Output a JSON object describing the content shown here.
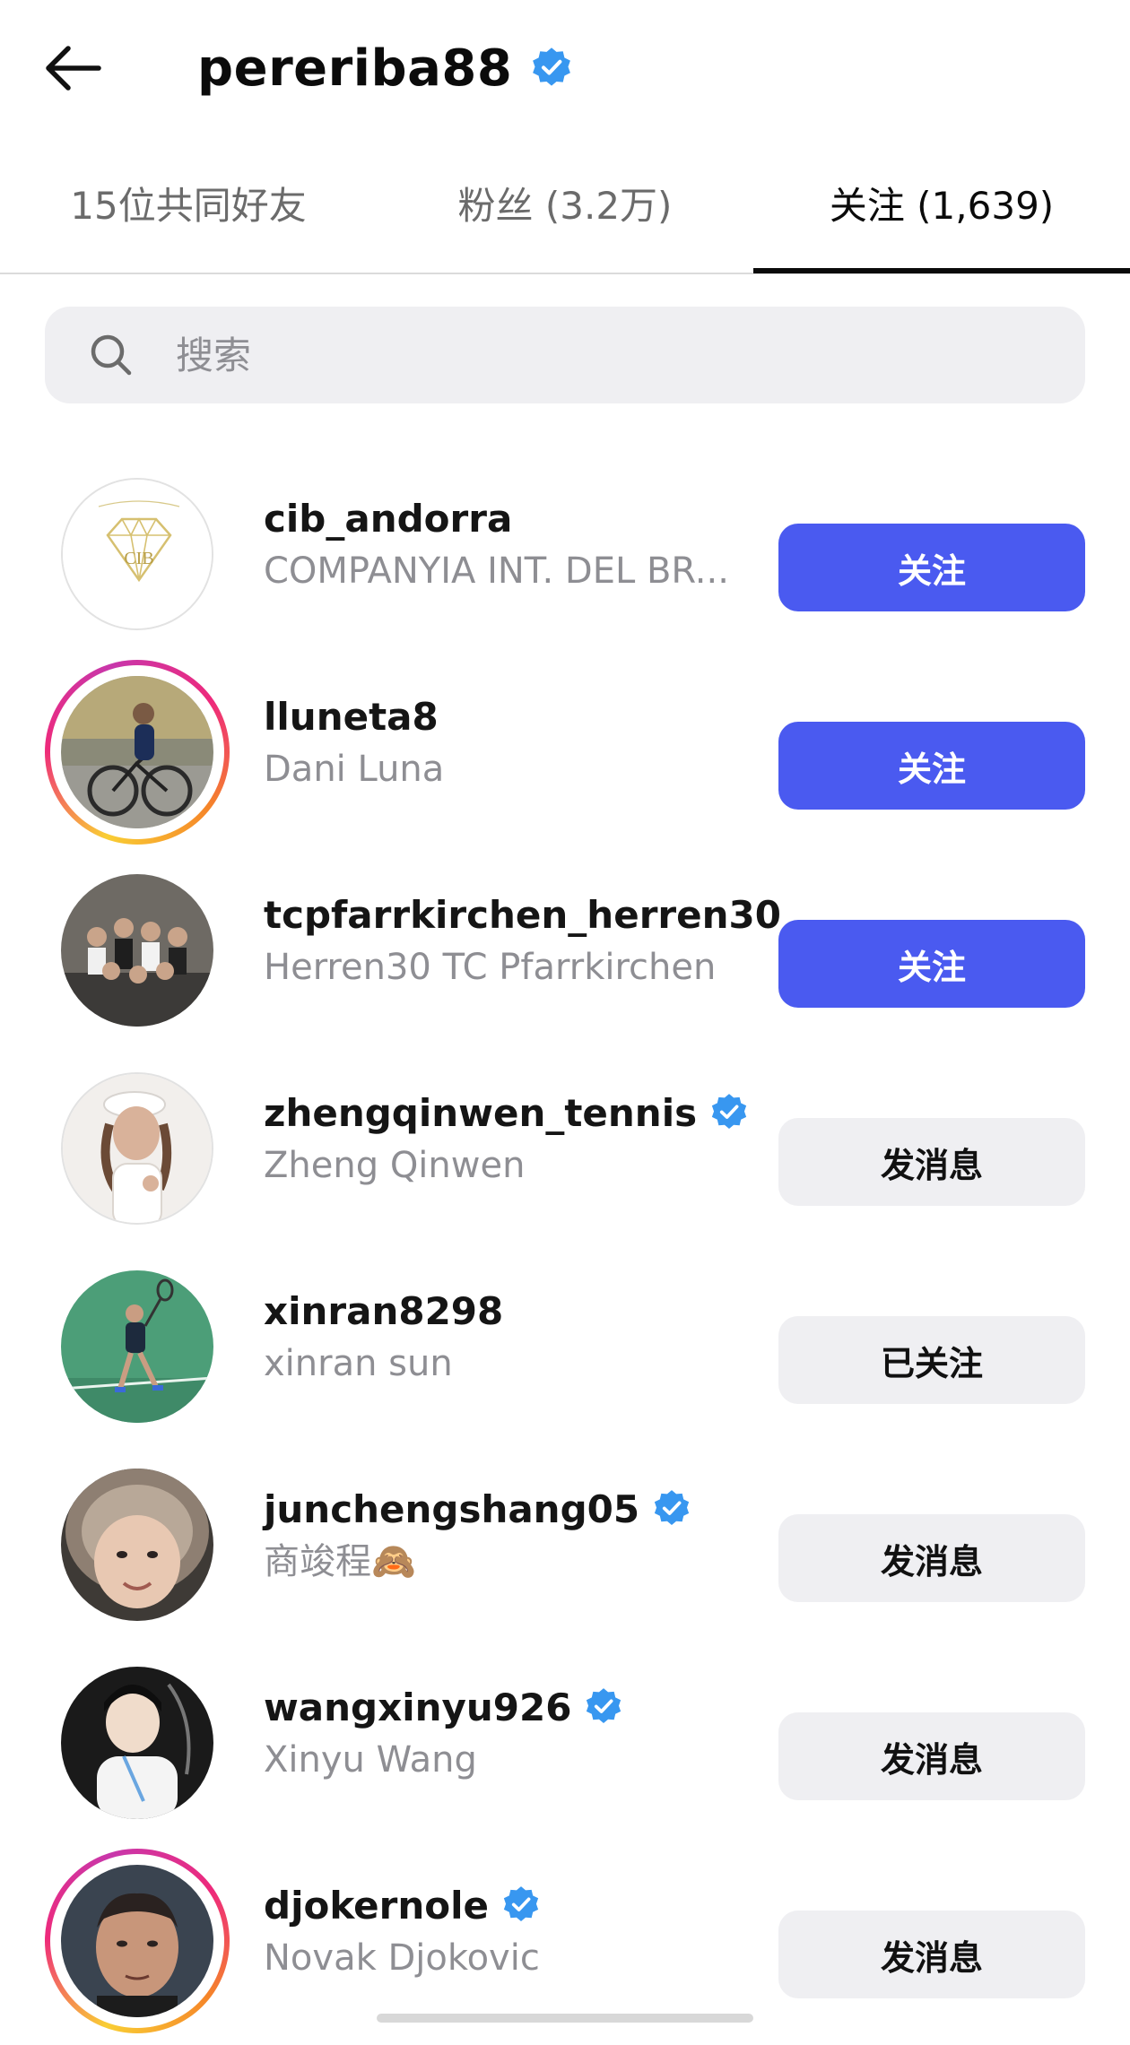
{
  "header": {
    "title": "pereriba88",
    "verified": true
  },
  "tabs": [
    {
      "label": "15位共同好友",
      "active": false
    },
    {
      "label": "粉丝 (3.2万)",
      "active": false
    },
    {
      "label": "关注 (1,639)",
      "active": true
    }
  ],
  "search": {
    "placeholder": "搜索",
    "value": ""
  },
  "users": [
    {
      "username": "cib_andorra",
      "full_name": "COMPANYIA INT. DEL BR...",
      "verified": false,
      "story_ring": false,
      "button": "关注",
      "button_style": "primary",
      "avatar_icon": "diamond-logo"
    },
    {
      "username": "lluneta8",
      "full_name": "Dani Luna",
      "verified": false,
      "story_ring": true,
      "button": "关注",
      "button_style": "primary",
      "avatar_icon": "cyclist-photo"
    },
    {
      "username": "tcpfarrkirchen_herren30",
      "full_name": "Herren30 TC Pfarrkirchen",
      "verified": false,
      "story_ring": false,
      "button": "关注",
      "button_style": "primary",
      "avatar_icon": "team-photo"
    },
    {
      "username": "zhengqinwen_tennis",
      "full_name": "Zheng Qinwen",
      "verified": true,
      "story_ring": false,
      "button": "发消息",
      "button_style": "secondary",
      "avatar_icon": "portrait-photo"
    },
    {
      "username": "xinran8298",
      "full_name": "xinran sun",
      "verified": false,
      "story_ring": false,
      "button": "已关注",
      "button_style": "secondary",
      "avatar_icon": "tennis-court-photo"
    },
    {
      "username": "junchengshang05",
      "full_name": "商竣程🙈",
      "verified": true,
      "story_ring": false,
      "button": "发消息",
      "button_style": "secondary",
      "avatar_icon": "portrait-photo"
    },
    {
      "username": "wangxinyu926",
      "full_name": "Xinyu Wang",
      "verified": true,
      "story_ring": false,
      "button": "发消息",
      "button_style": "secondary",
      "avatar_icon": "portrait-photo"
    },
    {
      "username": "djokernole",
      "full_name": "Novak Djokovic",
      "verified": true,
      "story_ring": true,
      "button": "发消息",
      "button_style": "secondary",
      "avatar_icon": "portrait-photo"
    }
  ],
  "colors": {
    "primary": "#4a5af0",
    "secondary_bg": "#efeff2",
    "verified": "#3897f0",
    "muted": "#8e8e93"
  }
}
